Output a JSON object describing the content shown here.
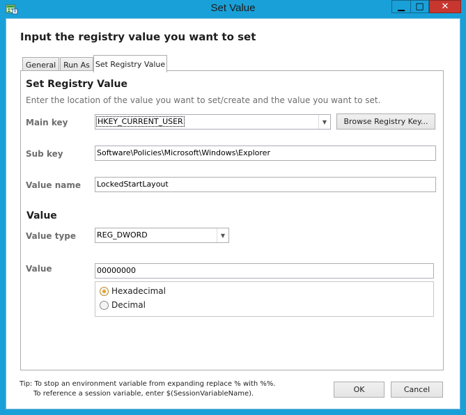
{
  "window": {
    "title": "Set Value",
    "minimize_glyph": "▁",
    "maximize_glyph": "□",
    "close_glyph": "✕"
  },
  "dialog": {
    "heading": "Input the registry value you want to set"
  },
  "tabs": [
    {
      "label": "General"
    },
    {
      "label": "Run As"
    },
    {
      "label": "Set Registry Value"
    }
  ],
  "registry": {
    "section_title": "Set Registry Value",
    "description": "Enter the location of the value you want to set/create and the value you want to set.",
    "main_key_label": "Main key",
    "main_key_value": "HKEY_CURRENT_USER",
    "browse_label": "Browse Registry Key...",
    "sub_key_label": "Sub key",
    "sub_key_value": "Software\\Policies\\Microsoft\\Windows\\Explorer",
    "value_name_label": "Value name",
    "value_name_value": "LockedStartLayout"
  },
  "value": {
    "section_title": "Value",
    "type_label": "Value type",
    "type_value": "REG_DWORD",
    "value_label": "Value",
    "value_value": "00000000",
    "radio_hex": "Hexadecimal",
    "radio_dec": "Decimal"
  },
  "footer": {
    "tip_line1": "Tip: To stop an environment variable from expanding replace % with %%.",
    "tip_line2": "To reference a session variable, enter $(SessionVariableName).",
    "ok_label": "OK",
    "cancel_label": "Cancel"
  },
  "colors": {
    "titlebar": "#1aa0d8",
    "close_button": "#c7372f",
    "radio_checked": "#e6a21a"
  }
}
